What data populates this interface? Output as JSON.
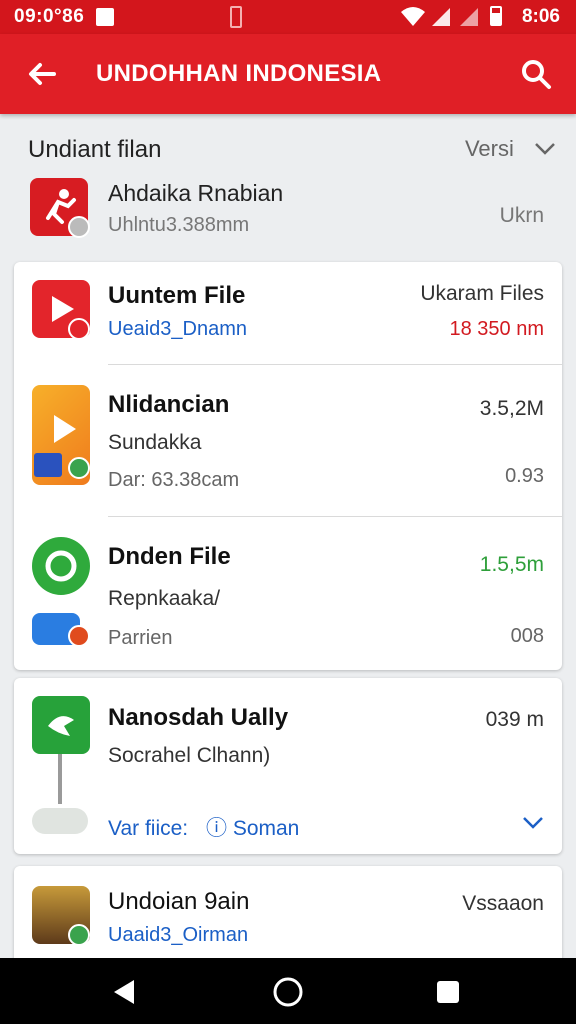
{
  "status_bar": {
    "time_left": "09:0°86",
    "time_right": "8:06",
    "icons": [
      "notification-icon",
      "wifi-icon",
      "signal-icon",
      "battery-icon"
    ]
  },
  "app_bar": {
    "title": "UNDOHHAN INDONESIA",
    "back_icon": "arrow-back-icon",
    "search_icon": "search-icon"
  },
  "section": {
    "label": "Undiant filan",
    "sort_label": "Versi"
  },
  "top_item": {
    "title": "Ahdaika Rnabian",
    "subtitle": "Uhlntu3.388mm",
    "right": "Ukrn"
  },
  "card1": {
    "items": [
      {
        "title": "Uuntem File",
        "subtitle": "Ueaid3_Dnamn",
        "right_top": "Ukaram Files",
        "right_bottom": "18 350 nm"
      },
      {
        "title": "Nlidancian",
        "subtitle": "Sundakka",
        "meta": "Dar: 63.38cam",
        "right_top": "3.5,2M",
        "right_bottom": "0.93"
      },
      {
        "title": "Dnden File",
        "subtitle": "Repnkaaka/",
        "meta": "Parrien",
        "right_top": "1.5,5m",
        "right_bottom": "008"
      }
    ]
  },
  "card2": {
    "title": "Nanosdah Ually",
    "subtitle": "Socrahel Clhann)",
    "right_top": "039 m",
    "link_prefix": "Var fiice:",
    "link_value": "Soman"
  },
  "card3": {
    "title": "Undoian 9ain",
    "subtitle": "Uaaid3_Oirman",
    "right_top": "Vssaaon"
  },
  "colors": {
    "brand": "#e01f26",
    "status": "#d3161c",
    "link": "#1b5fc6",
    "accent_green": "#2e9f3a"
  },
  "nav": {
    "back": "nav-back-icon",
    "home": "nav-home-icon",
    "recent": "nav-recent-icon"
  }
}
